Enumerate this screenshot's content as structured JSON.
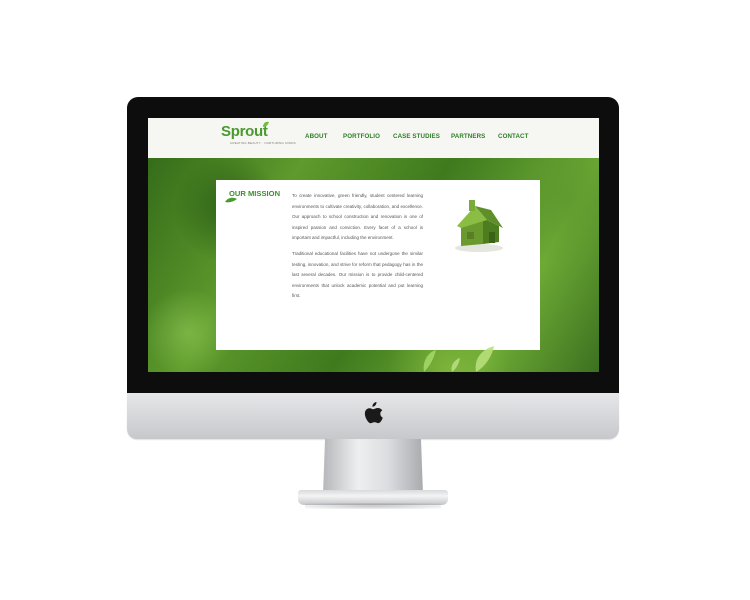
{
  "site": {
    "logo": {
      "word": "Sprout",
      "tagline": "CREATING BEAUTY · NURTURING MINDS"
    },
    "nav": [
      {
        "label": "ABOUT"
      },
      {
        "label": "PORTFOLIO"
      },
      {
        "label": "CASE STUDIES"
      },
      {
        "label": "PARTNERS"
      },
      {
        "label": "CONTACT"
      }
    ]
  },
  "mission": {
    "heading": "OUR MISSION",
    "paragraphs": [
      "To create innovative, green friendly, student centered learning environments to cultivate creativity, collaboration, and excellence. Our approach to school construction and renovation is one of inspired passion and conviction. Every facet of a school is important and impactful, including the environment.",
      "Traditional educational facilities have not undergone the similar testing, innovation, and strive for reform that pedagogy has in the last several decades. Our mission is to provide child-centered environments that unlock academic potential and put learning first."
    ]
  },
  "colors": {
    "brand_green": "#3b8f2a",
    "nav_green": "#2f7f26",
    "header_bg": "#f6f6f2",
    "body_text": "#555555"
  },
  "icons": {
    "monitor_logo": "apple-logo-icon",
    "hero_image": "grass-house-icon",
    "heading_accent": "leaf-icon"
  }
}
